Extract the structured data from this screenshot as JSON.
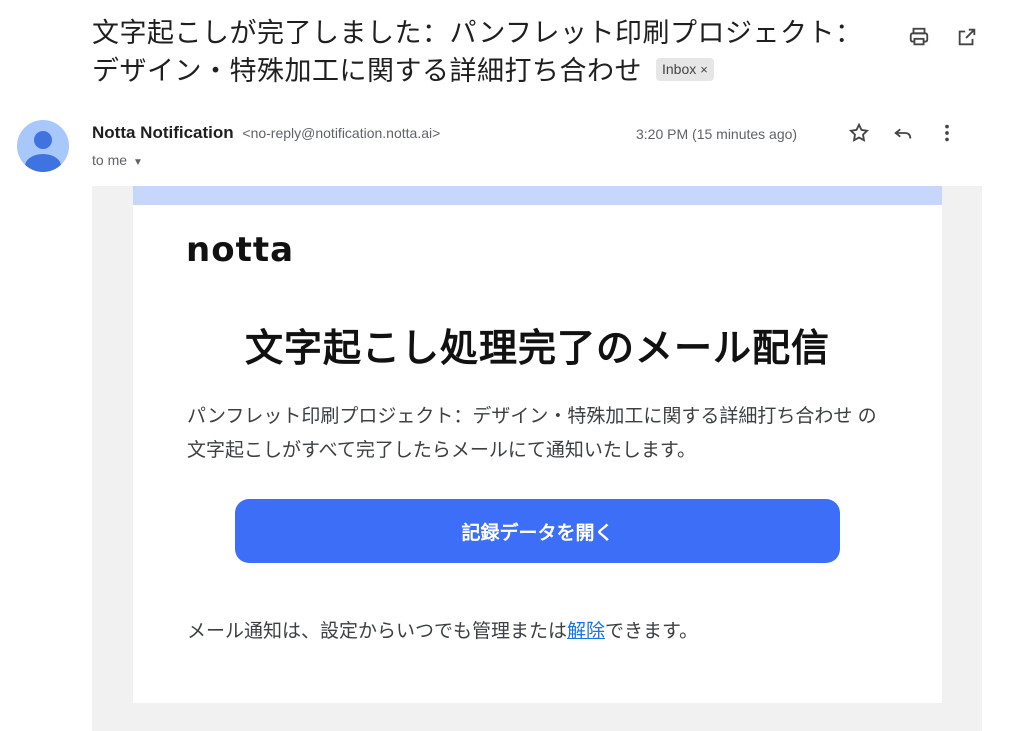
{
  "email": {
    "subject": "文字起こしが完了しました：パンフレット印刷プロジェクト：デザイン・特殊加工に関する詳細打ち合わせ",
    "label": "Inbox",
    "sender_name": "Notta Notification",
    "sender_address": "<no-reply@notification.notta.ai>",
    "recipient": "to me",
    "timestamp": "3:20 PM (15 minutes ago)"
  },
  "toolbar": {
    "icons": [
      "print-icon",
      "open-in-new-window-icon",
      "star-icon",
      "reply-icon",
      "more-vert-icon"
    ]
  },
  "body": {
    "brand": "notta",
    "headline": "文字起こし処理完了のメール配信",
    "description": "パンフレット印刷プロジェクト：デザイン・特殊加工に関する詳細打ち合わせ の文字起こしがすべて完了したらメールにて通知いたします。",
    "cta_label": "記録データを開く",
    "footer_prefix": "メール通知は、設定からいつでも管理または",
    "footer_link": "解除",
    "footer_suffix": "できます。"
  },
  "colors": {
    "accent": "#3d6ef7",
    "band": "#c6d7fb",
    "avatar": "#a8c7fa",
    "link": "#1a73e8"
  }
}
